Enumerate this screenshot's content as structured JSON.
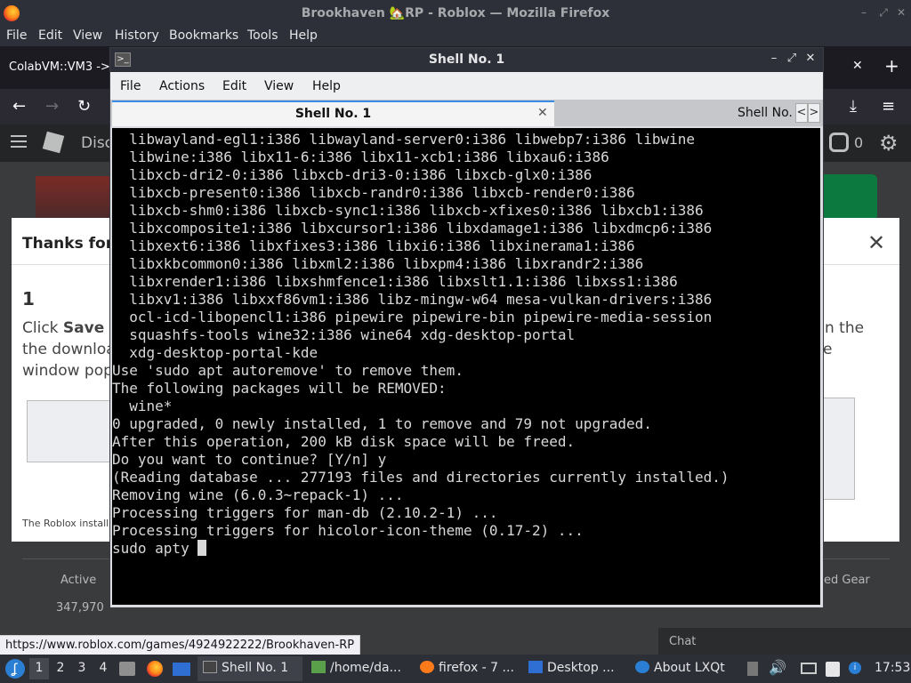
{
  "firefox": {
    "window_title": "Brookhaven 🏡RP - Roblox — Mozilla Firefox",
    "window_buttons": [
      "–",
      "⤢",
      "✕"
    ],
    "menu": [
      "File",
      "Edit",
      "View",
      "History",
      "Bookmarks",
      "Tools",
      "Help"
    ],
    "tab_title": "ColabVM::VM3 ->",
    "tab_close": "✕",
    "new_tab": "+",
    "nav": {
      "back": "←",
      "forward": "→",
      "reload": "↻",
      "download": "⤓",
      "menu": "≡"
    },
    "status_url": "https://www.roblox.com/games/4924922222/Brookhaven-RP"
  },
  "roblox": {
    "header_fragment": "Disc",
    "robux_count": "0",
    "modal": {
      "title": "Thanks for v",
      "close": "✕",
      "step": "1",
      "line1_pre": "Click ",
      "line1_bold": "Save F",
      "line2": "the download",
      "line3": "window pop",
      "right1": "n the",
      "right2": "e",
      "footer": "The Roblox installe"
    },
    "stats": {
      "labels": [
        "Active",
        "ed Gear"
      ],
      "values": [
        "347,970"
      ]
    },
    "chat_label": "Chat"
  },
  "terminal": {
    "window_title": "Shell No. 1",
    "window_buttons": [
      "–",
      "⤢",
      "✕"
    ],
    "menu": [
      "File",
      "Actions",
      "Edit",
      "View",
      "Help"
    ],
    "tab_active": "Shell No. 1",
    "tab_close": "✕",
    "tab_second": "Shell No.",
    "tab_prev": "<",
    "tab_next": ">",
    "lines": [
      "  libwayland-egl1:i386 libwayland-server0:i386 libwebp7:i386 libwine",
      "  libwine:i386 libx11-6:i386 libx11-xcb1:i386 libxau6:i386",
      "  libxcb-dri2-0:i386 libxcb-dri3-0:i386 libxcb-glx0:i386",
      "  libxcb-present0:i386 libxcb-randr0:i386 libxcb-render0:i386",
      "  libxcb-shm0:i386 libxcb-sync1:i386 libxcb-xfixes0:i386 libxcb1:i386",
      "  libxcomposite1:i386 libxcursor1:i386 libxdamage1:i386 libxdmcp6:i386",
      "  libxext6:i386 libxfixes3:i386 libxi6:i386 libxinerama1:i386",
      "  libxkbcommon0:i386 libxml2:i386 libxpm4:i386 libxrandr2:i386",
      "  libxrender1:i386 libxshmfence1:i386 libxslt1.1:i386 libxss1:i386",
      "  libxv1:i386 libxxf86vm1:i386 libz-mingw-w64 mesa-vulkan-drivers:i386",
      "  ocl-icd-libopencl1:i386 pipewire pipewire-bin pipewire-media-session",
      "  squashfs-tools wine32:i386 wine64 xdg-desktop-portal",
      "  xdg-desktop-portal-kde",
      "Use 'sudo apt autoremove' to remove them.",
      "The following packages will be REMOVED:",
      "  wine*",
      "0 upgraded, 0 newly installed, 1 to remove and 79 not upgraded.",
      "After this operation, 200 kB disk space will be freed.",
      "Do you want to continue? [Y/n] y",
      "(Reading database ... 277193 files and directories currently installed.)",
      "Removing wine (6.0.3~repack-1) ...",
      "Processing triggers for man-db (2.10.2-1) ...",
      "Processing triggers for hicolor-icon-theme (0.17-2) ..."
    ],
    "prompt_input": "sudo apty "
  },
  "panel": {
    "desktops": [
      "1",
      "2",
      "3",
      "4"
    ],
    "active_desktop": "1",
    "tasks": [
      "Shell No. 1",
      "/home/da...",
      "firefox - 7 ...",
      "Desktop ...",
      "About LXQt"
    ],
    "clock": "17:53"
  }
}
